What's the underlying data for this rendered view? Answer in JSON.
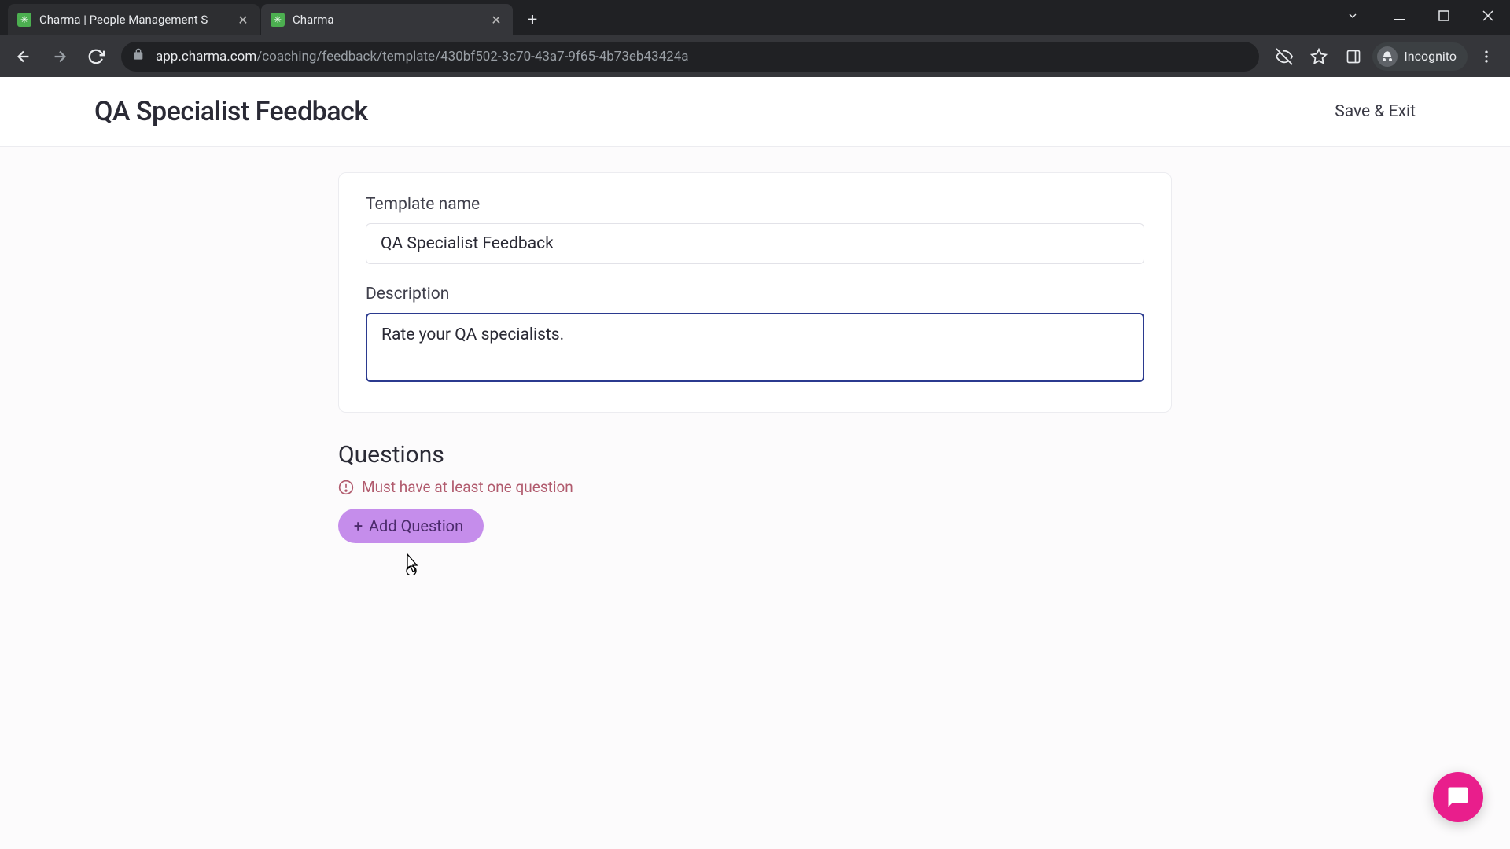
{
  "browser": {
    "tabs": [
      {
        "title": "Charma | People Management S",
        "active": false
      },
      {
        "title": "Charma",
        "active": true
      }
    ],
    "url_host": "app.charma.com",
    "url_path": "/coaching/feedback/template/430bf502-3c70-43a7-9f65-4b73eb43424a",
    "incognito_label": "Incognito"
  },
  "header": {
    "title": "QA Specialist Feedback",
    "save_exit_label": "Save & Exit"
  },
  "form": {
    "template_name_label": "Template name",
    "template_name_value": "QA Specialist Feedback",
    "description_label": "Description",
    "description_value": "Rate your QA specialists."
  },
  "questions": {
    "heading": "Questions",
    "validation_text": "Must have at least one question",
    "add_button_label": "Add Question"
  }
}
